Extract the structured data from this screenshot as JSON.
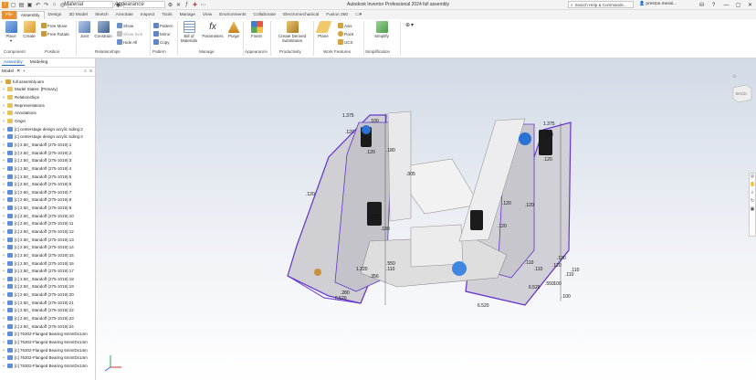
{
  "app": {
    "title": "Autodesk Inventor Professional 2024  full assembly",
    "search_placeholder": "Search Help & Commands...",
    "user": "preston.messi...",
    "material_placeholder": "Material",
    "appearance_placeholder": "Appearance"
  },
  "tabs": [
    "File",
    "Assembly",
    "Design",
    "3D Model",
    "Sketch",
    "Annotate",
    "Inspect",
    "Tools",
    "Manage",
    "View",
    "Environments",
    "Collaborate",
    "Electromechanical",
    "Fusion 360"
  ],
  "ribbon": {
    "place": "Place",
    "create": "Create",
    "free_move": "Free Move",
    "free_rotate": "Free Rotate",
    "joint": "Joint",
    "constrain": "Constrain",
    "show": "Show",
    "show_sick": "Show Sick",
    "hide_all": "Hide All",
    "pattern": "Pattern",
    "mirror": "Mirror",
    "copy": "Copy",
    "bill_of_materials": "Bill of Materials",
    "parameters": "Parameters",
    "purge": "Purge",
    "finish": "Finish",
    "create_derived": "Create Derived Substitutes",
    "plane": "Plane",
    "axis": "Axis",
    "point": "Point",
    "ucs": "UCS",
    "simplify": "Simplify",
    "groups": [
      "Component",
      "Position",
      "Relationships",
      "Pattern",
      "Manage",
      "Appearance",
      "Productivity",
      "Work Features",
      "Simplification"
    ]
  },
  "panel": {
    "tabs": [
      "Assembly",
      "Modeling"
    ],
    "active_tab": "Assembly",
    "sub_title": "Model",
    "root": "full assembly.iam",
    "nodes": [
      "Model States: [Primary]",
      "Relationships",
      "Representations",
      "Annotations",
      "Origin",
      "[c] centerstage design acrylic siding:2",
      "[c] centerstage design acrylic siding:4",
      "[c] 2.50_ Standoff (275-1019):1",
      "[c] 2.50_ Standoff (275-1019):2",
      "[c] 2.50_ Standoff (275-1019):3",
      "[c] 2.50_ Standoff (275-1019):4",
      "[c] 2.50_ Standoff (275-1019):5",
      "[c] 2.50_ Standoff (275-1019):6",
      "[c] 2.50_ Standoff (275-1019):7",
      "[c] 2.50_ Standoff (275-1019):8",
      "[c] 2.50_ Standoff (275-1019):9",
      "[c] 2.50_ Standoff (275-1019):10",
      "[c] 2.50_ Standoff (275-1019):11",
      "[c] 2.50_ Standoff (275-1019):12",
      "[c] 2.50_ Standoff (275-1019):13",
      "[c] 2.50_ Standoff (275-1019):14",
      "[c] 2.50_ Standoff (275-1019):15",
      "[c] 2.50_ Standoff (275-1019):16",
      "[c] 2.50_ Standoff (275-1019):17",
      "[c] 2.50_ Standoff (275-1019):18",
      "[c] 2.50_ Standoff (275-1019):19",
      "[c] 2.50_ Standoff (275-1019):20",
      "[c] 2.50_ Standoff (275-1019):21",
      "[c] 2.50_ Standoff (275-1019):22",
      "[c] 2.50_ Standoff (275-1019):23",
      "[c] 2.50_ Standoff (275-1019):24",
      "[c] 76302-Flanged Bearing 6mmIDx14m",
      "[c] 76302-Flanged Bearing 6mmIDx14m",
      "[c] 76302-Flanged Bearing 6mmIDx14m",
      "[c] 76302-Flanged Bearing 6mmIDx14m",
      "[c] 76302-Flanged Bearing 6mmIDx14m"
    ]
  },
  "viewport": {
    "viewcube_label": "BACK",
    "dimensions": [
      "1.375",
      "1.375",
      ".100",
      ".120",
      ".120",
      ".120",
      ".120",
      ".120",
      ".120",
      ".120",
      ".120",
      ".120",
      ".110",
      ".110",
      ".110",
      ".130",
      ".550",
      ".100",
      "6.520",
      "6.520",
      ".280",
      "1.220",
      ".180",
      ".180",
      "6.520",
      ".110",
      ".120",
      ".110",
      ".005",
      ".356",
      ".550",
      ".100"
    ]
  },
  "colors": {
    "accent": "#1f5fb0",
    "file_tab": "#ec8f2f",
    "sketch_line": "#6633cc"
  }
}
